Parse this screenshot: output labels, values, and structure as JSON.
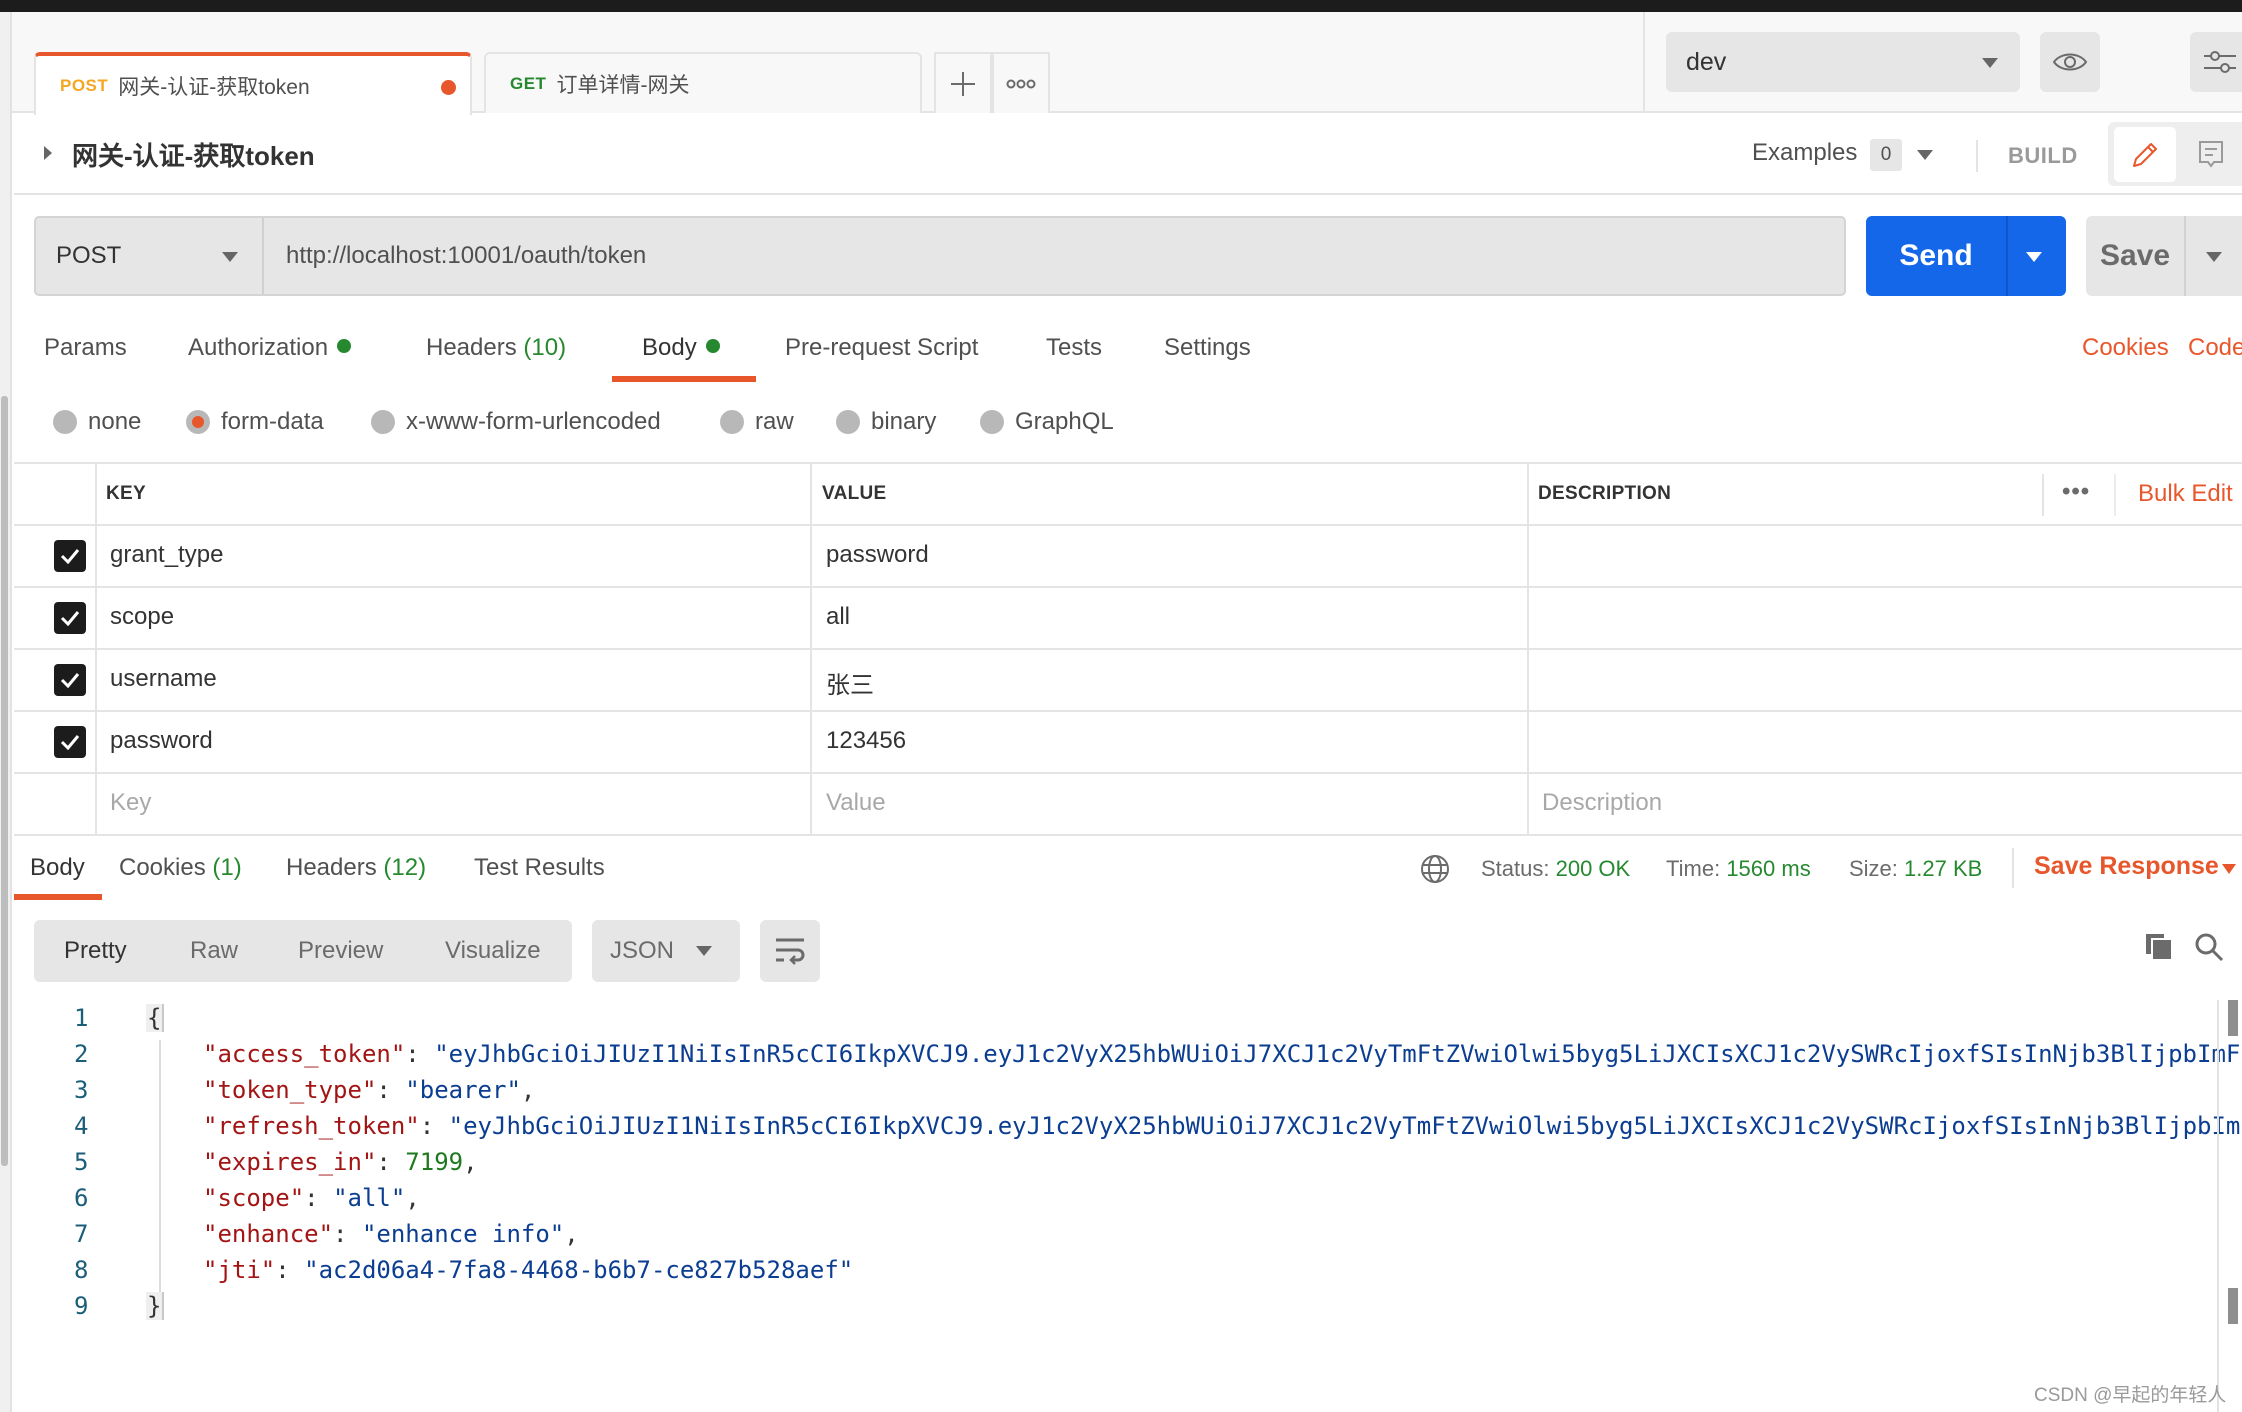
{
  "tabs": [
    {
      "method": "POST",
      "method_color": "#f5a623",
      "name": "网关-认证-获取token",
      "active": true,
      "unsaved": true
    },
    {
      "method": "GET",
      "method_color": "#26892f",
      "name": "订单详情-网关",
      "active": false,
      "unsaved": false
    }
  ],
  "tab_tools": {
    "add_icon": "plus-icon",
    "more_icon": "more-options-icon",
    "add_glyph": "+",
    "more_glyph": "ooo"
  },
  "environment": {
    "selected": "dev",
    "quick_look_icon": "eye-icon",
    "manage_icon": "sliders-icon"
  },
  "request": {
    "title": "网关-认证-获取token",
    "examples_label": "Examples",
    "examples_count": "0",
    "build_label": "BUILD",
    "method": "POST",
    "url": "http://localhost:10001/oauth/token",
    "send_label": "Send",
    "save_label": "Save"
  },
  "request_tabs": [
    {
      "label": "Params"
    },
    {
      "label": "Authorization",
      "dot": true
    },
    {
      "label": "Headers",
      "count": "(10)"
    },
    {
      "label": "Body",
      "dot": true,
      "active": true
    },
    {
      "label": "Pre-request Script"
    },
    {
      "label": "Tests"
    },
    {
      "label": "Settings"
    }
  ],
  "request_links": {
    "cookies": "Cookies",
    "code": "Code"
  },
  "body_types": [
    {
      "label": "none"
    },
    {
      "label": "form-data",
      "checked": true
    },
    {
      "label": "x-www-form-urlencoded"
    },
    {
      "label": "raw"
    },
    {
      "label": "binary"
    },
    {
      "label": "GraphQL"
    }
  ],
  "params_table": {
    "headers": {
      "key": "KEY",
      "value": "VALUE",
      "description": "DESCRIPTION"
    },
    "more_glyph": "•••",
    "bulk_edit": "Bulk Edit",
    "rows": [
      {
        "checked": true,
        "key": "grant_type",
        "value": "password",
        "description": ""
      },
      {
        "checked": true,
        "key": "scope",
        "value": "all",
        "description": ""
      },
      {
        "checked": true,
        "key": "username",
        "value": "张三",
        "description": ""
      },
      {
        "checked": true,
        "key": "password",
        "value": "123456",
        "description": ""
      }
    ],
    "placeholders": {
      "key": "Key",
      "value": "Value",
      "description": "Description"
    }
  },
  "response_tabs": [
    {
      "label": "Body",
      "active": true
    },
    {
      "label": "Cookies",
      "count": "(1)"
    },
    {
      "label": "Headers",
      "count": "(12)"
    },
    {
      "label": "Test Results"
    }
  ],
  "response_status": {
    "status_label": "Status:",
    "status_value": "200 OK",
    "time_label": "Time:",
    "time_value": "1560 ms",
    "size_label": "Size:",
    "size_value": "1.27 KB",
    "save_response": "Save Response"
  },
  "response_view": {
    "modes": [
      "Pretty",
      "Raw",
      "Preview",
      "Visualize"
    ],
    "active_mode": "Pretty",
    "format": "JSON"
  },
  "response_body": {
    "line_numbers": [
      "1",
      "2",
      "3",
      "4",
      "5",
      "6",
      "7",
      "8",
      "9"
    ],
    "open_brace": "{",
    "close_brace": "}",
    "entries": [
      {
        "key": "\"access_token\"",
        "value": "\"eyJhbGciOiJIUzI1NiIsInR5cCI6IkpXVCJ9.eyJ1c2VyX25hbWUiOiJ7XCJ1c2VyTmFtZVwiOlwi5byg5LiJXCIsXCJ1c2VySWRcIjoxfSIsInNjb3BlIjpbImF",
        "type": "string",
        "trail": ""
      },
      {
        "key": "\"token_type\"",
        "value": "\"bearer\"",
        "type": "string",
        "trail": ","
      },
      {
        "key": "\"refresh_token\"",
        "value": "\"eyJhbGciOiJIUzI1NiIsInR5cCI6IkpXVCJ9.eyJ1c2VyX25hbWUiOiJ7XCJ1c2VyTmFtZVwiOlwi5byg5LiJXCIsXCJ1c2VySWRcIjoxfSIsInNjb3BlIjpbIm",
        "type": "string",
        "trail": ""
      },
      {
        "key": "\"expires_in\"",
        "value": "7199",
        "type": "number",
        "trail": ","
      },
      {
        "key": "\"scope\"",
        "value": "\"all\"",
        "type": "string",
        "trail": ","
      },
      {
        "key": "\"enhance\"",
        "value": "\"enhance info\"",
        "type": "string",
        "trail": ","
      },
      {
        "key": "\"jti\"",
        "value": "\"ac2d06a4-7fa8-4468-b6b7-ce827b528aef\"",
        "type": "string",
        "trail": ""
      }
    ]
  },
  "colors": {
    "accent": "#e8572c",
    "primary": "#1467e8",
    "success": "#26892f",
    "post": "#f5a623"
  },
  "watermark": "CSDN @早起的年轻人"
}
